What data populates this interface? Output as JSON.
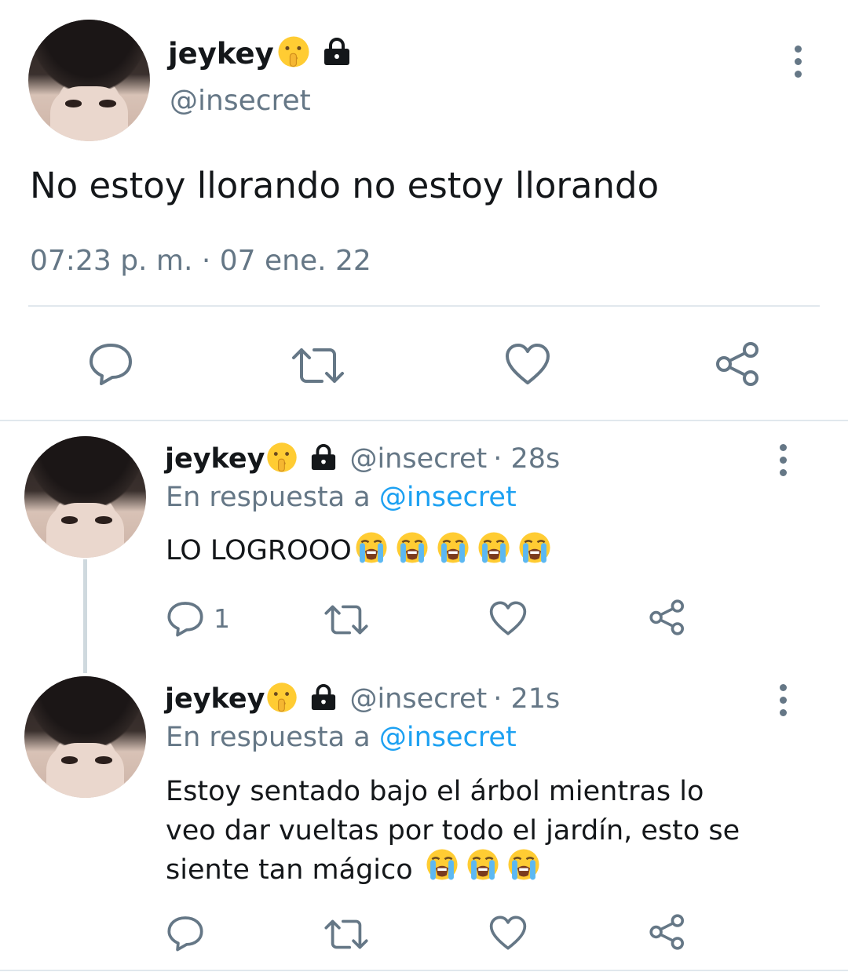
{
  "main_tweet": {
    "display_name": "jeykey",
    "handle": "@insecret",
    "text": "No estoy llorando no estoy llorando",
    "timestamp": "07:23 p. m. · 07 ene. 22"
  },
  "replies": [
    {
      "display_name": "jeykey",
      "handle": "@insecret",
      "age": "· 28s",
      "reply_prefix": "En respuesta a",
      "reply_to": "@insecret",
      "text": "LO LOGROOO",
      "emojis": [
        "loudly-crying-face",
        "loudly-crying-face",
        "loudly-crying-face",
        "loudly-crying-face",
        "loudly-crying-face"
      ],
      "reply_count": "1"
    },
    {
      "display_name": "jeykey",
      "handle": "@insecret",
      "age": "· 21s",
      "reply_prefix": "En respuesta a",
      "reply_to": "@insecret",
      "text_lines": [
        "Estoy sentado bajo el árbol mientras lo",
        "veo dar vueltas por todo el jardín, esto se",
        "siente tan mágico"
      ],
      "emojis": [
        "loudly-crying-face",
        "loudly-crying-face",
        "loudly-crying-face"
      ],
      "reply_count": ""
    }
  ],
  "icons": {
    "name_emoji": "shushing-face",
    "protected": "lock-icon",
    "more": "more-vertical-icon",
    "reply": "reply-icon",
    "retweet": "retweet-icon",
    "like": "heart-icon",
    "share": "share-icon"
  },
  "colors": {
    "text": "#14171a",
    "muted": "#657786",
    "link": "#1da1f2",
    "divider": "#e1e8ed"
  }
}
